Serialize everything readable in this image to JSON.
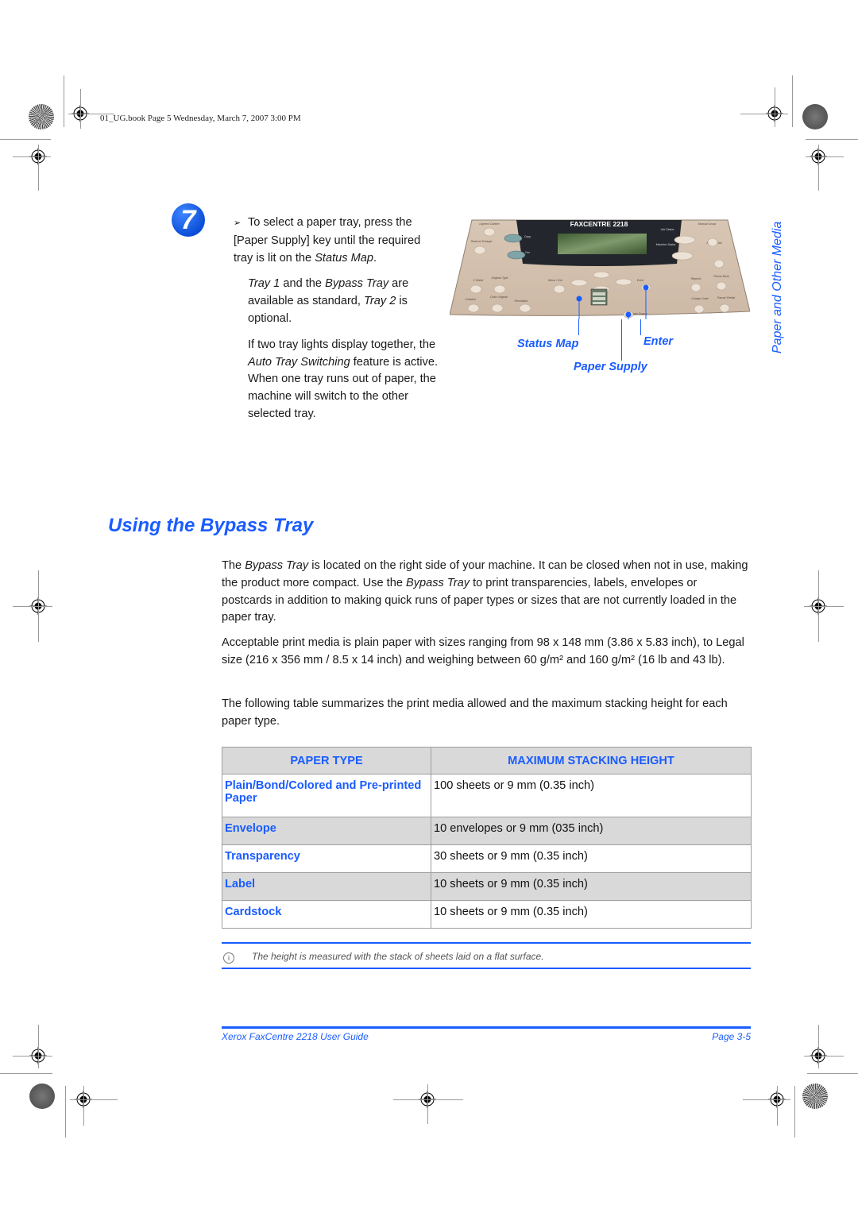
{
  "print_slug": "01_UG.book  Page 5  Wednesday, March 7, 2007  3:00 PM",
  "step": {
    "number": "7",
    "bullet_icon": "arrow-bullet-icon",
    "paragraph1": {
      "pre": "To select a paper tray, press the [Paper Supply] key until the required tray is lit on the ",
      "em": "Status Map",
      "post": "."
    },
    "paragraph2": {
      "em1": "Tray 1",
      "t1": " and the ",
      "em2": "Bypass Tray",
      "t2": " are available as standard, ",
      "em3": "Tray 2",
      "t3": " is optional."
    },
    "paragraph3": {
      "pre": "If two tray lights display together, the ",
      "em": "Auto Tray Switching",
      "post": " feature is active. When one tray runs out of paper, the machine will switch to the other selected tray."
    }
  },
  "control_panel": {
    "model_label": "FAXCENTRE 2218",
    "buttons": {
      "lighten_darken": "Lighten/ Darken",
      "reduce_enlarge": "Reduce/ Enlarge",
      "copy": "Copy",
      "fax": "Fax",
      "two_sided": "2 Sided",
      "original_type": "Original Type",
      "collated": "Collated",
      "color_original": "Color Original",
      "resolution": "Resolution",
      "menu_exit": "Menu / Exit",
      "enter": "Enter",
      "paper_supply": "Paper Supply",
      "job_status": "Job Status",
      "machine_status": "Machine Status",
      "manual_group": "Manual Group",
      "manual_dial": "Manual Dial",
      "reports": "Reports",
      "phone_book": "Phone Book",
      "charge_code": "Charge Code",
      "pause_redial": "Pause/ Redial"
    },
    "callouts": {
      "status_map": "Status Map",
      "enter": "Enter",
      "paper_supply": "Paper Supply"
    },
    "callout_color": "#1a5cff"
  },
  "side_tab": "Paper and Other Media",
  "section_title": "Using the Bypass Tray",
  "paragraphs": {
    "p1": {
      "t1": "The ",
      "em1": "Bypass Tray",
      "t2": " is located on the right side of your machine. It can be closed when not in use, making the product more compact. Use the ",
      "em2": "Bypass Tray",
      "t3": " to print transparencies, labels, envelopes or postcards in addition to making quick runs of paper types or sizes that are not currently loaded in the paper tray."
    },
    "p2": "Acceptable print media is plain paper with sizes ranging from 98 x 148 mm (3.86 x 5.83 inch), to Legal size (216 x 356 mm / 8.5 x 14 inch) and weighing between 60 g/m² and 160 g/m² (16 lb and 43 lb).",
    "p3": "The following table summarizes the print media allowed and the maximum stacking height for each paper type."
  },
  "media_table": {
    "headers": [
      "PAPER TYPE",
      "MAXIMUM STACKING HEIGHT"
    ],
    "rows": [
      {
        "type": "Plain/Bond/Colored and Pre-printed Paper",
        "height": "100 sheets or 9 mm (0.35 inch)"
      },
      {
        "type": "Envelope",
        "height": "10 envelopes or 9 mm (035 inch)"
      },
      {
        "type": "Transparency",
        "height": "30 sheets or 9 mm (0.35 inch)"
      },
      {
        "type": "Label",
        "height": "10 sheets or 9 mm (0.35 inch)"
      },
      {
        "type": "Cardstock",
        "height": "10 sheets or 9 mm (0.35 inch)"
      }
    ]
  },
  "note": {
    "icon": "info-icon",
    "text": "The height is measured with the stack of sheets laid on a flat surface."
  },
  "footer": {
    "left": "Xerox FaxCentre 2218 User Guide",
    "right": "Page 3-5"
  },
  "colors": {
    "accent_blue": "#1a5cff",
    "table_shade": "#d9d9d9",
    "panel_beige": "#d9c6b4",
    "panel_dark": "#23262c"
  }
}
